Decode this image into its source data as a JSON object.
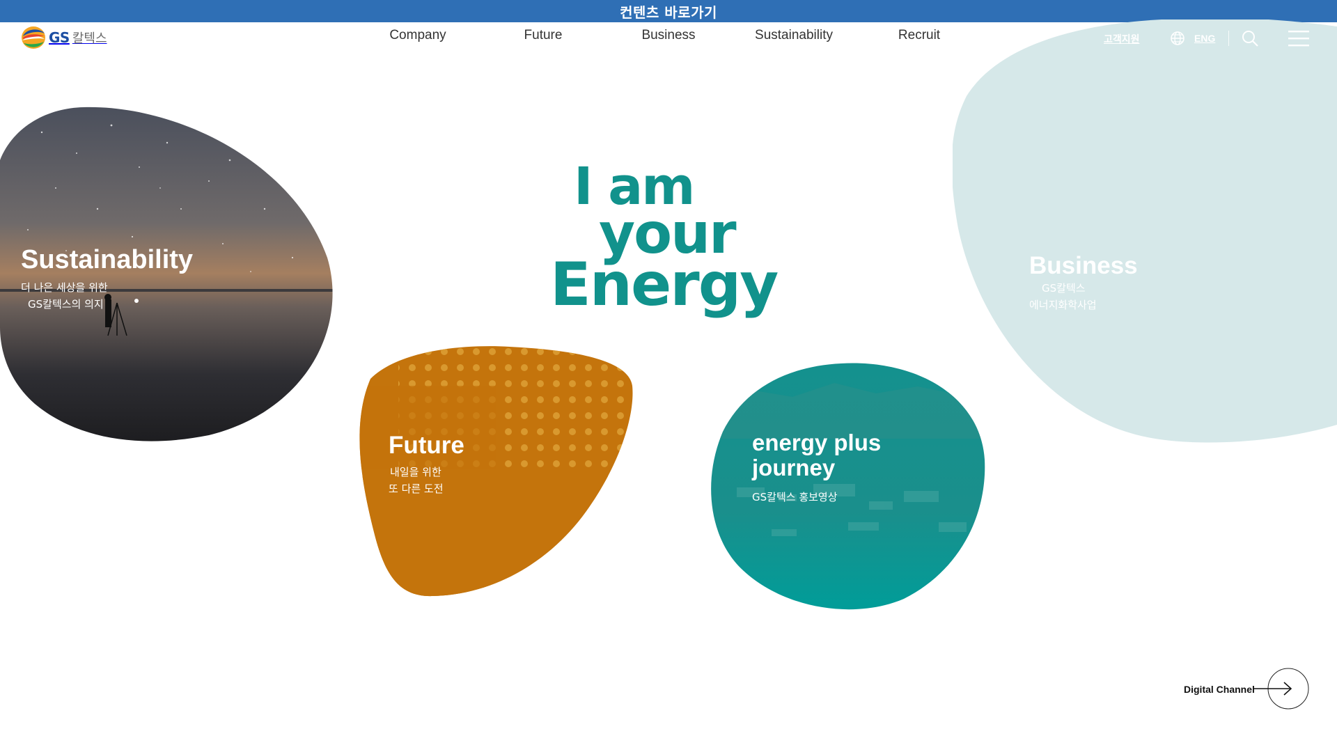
{
  "skip_link": "컨텐츠 바로가기",
  "brand": {
    "logo_gs": "GS",
    "logo_name": "칼텍스"
  },
  "nav": [
    {
      "label": "Company"
    },
    {
      "label": "Future"
    },
    {
      "label": "Business"
    },
    {
      "label": "Sustainability"
    },
    {
      "label": "Recruit"
    }
  ],
  "util": {
    "support": "고객지원",
    "language": "ENG",
    "globe_icon": "globe-icon",
    "search_icon": "search-icon",
    "menu_icon": "hamburger-menu-icon"
  },
  "slogan": {
    "line1": "I am",
    "line2": "your",
    "line3": "Energy"
  },
  "cards": {
    "sustainability": {
      "title": "Sustainability",
      "sub1": "더 나은 세상을 위한",
      "sub2": "GS칼텍스의 의지"
    },
    "business": {
      "title": "Business",
      "sub1": "GS칼텍스",
      "sub2": "에너지화학사업"
    },
    "future": {
      "title": "Future",
      "sub1": "내일을 위한",
      "sub2": "또 다른 도전"
    },
    "energy_plus": {
      "title": "energy plus journey",
      "sub1": "GS칼텍스 홍보영상"
    }
  },
  "digital_channel": {
    "label": "Digital Channel",
    "icon": "arrow-right-icon"
  },
  "colors": {
    "skip_bar": "#2f6fb5",
    "teal": "#11928c",
    "orange": "#c4740c",
    "business_blob": "#d6e8e9",
    "nav_text": "#333333"
  }
}
